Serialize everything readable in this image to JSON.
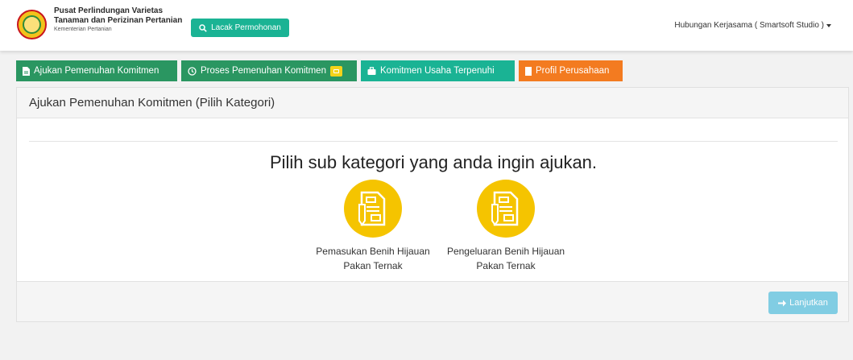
{
  "header": {
    "brand_line1": "Pusat Perlindungan Varietas",
    "brand_line2": "Tanaman dan Perizinan Pertanian",
    "brand_sub": "Kementerian Pertanian",
    "track_label": "Lacak Permohonan",
    "user_label": "Hubungan Kerjasama ( Smartsoft Studio )"
  },
  "tabs": [
    {
      "label": "Ajukan Pemenuhan Komitmen",
      "icon": "file-icon",
      "color": "#2a9661"
    },
    {
      "label": "Proses Pemenuhan Komitmen",
      "icon": "clock-icon",
      "color": "#2a9661"
    },
    {
      "label": "Komitmen Usaha Terpenuhi",
      "icon": "briefcase-icon",
      "color": "#1ab394"
    },
    {
      "label": "Profil Perusahaan",
      "icon": "bookmark-icon",
      "color": "#f37b20"
    }
  ],
  "panel": {
    "title": "Ajukan Pemenuhan Komitmen (Pilih Kategori)",
    "prompt": "Pilih sub kategori yang anda ingin ajukan.",
    "options": [
      {
        "line1": "Pemasukan Benih Hijauan",
        "line2": "Pakan Ternak",
        "icon": "document-pencil-icon"
      },
      {
        "line1": "Pengeluaran Benih Hijauan",
        "line2": "Pakan Ternak",
        "icon": "document-pencil-icon"
      }
    ],
    "next_label": "Lanjutkan"
  },
  "colors": {
    "accent_teal": "#1ab394",
    "accent_green": "#2a9661",
    "accent_orange": "#f37b20",
    "option_yellow": "#f5c400",
    "next_button": "#5bc0de"
  }
}
